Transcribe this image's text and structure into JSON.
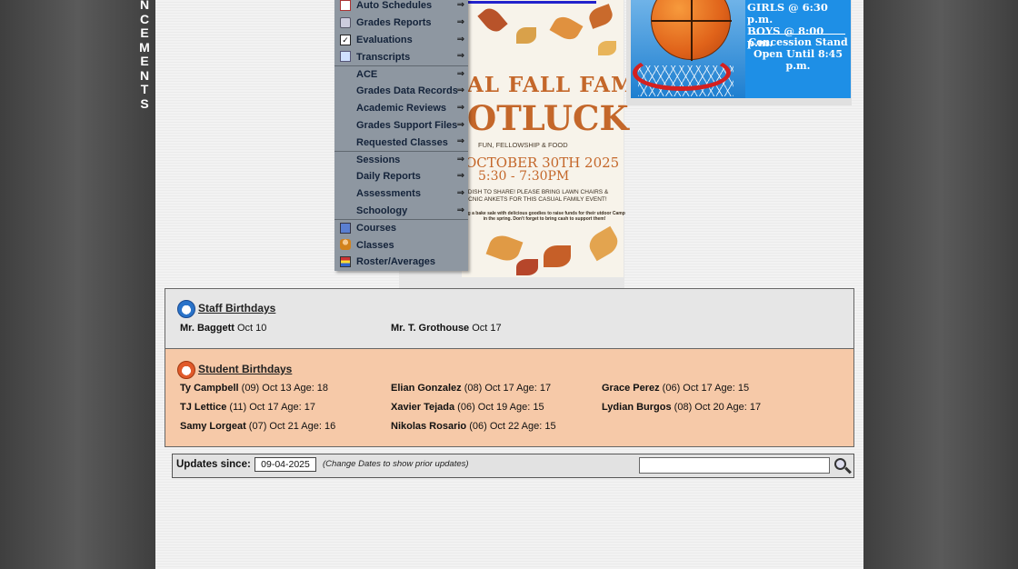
{
  "sidebar": {
    "vertical_letters": [
      "N",
      "C",
      "E",
      "M",
      "E",
      "N",
      "T",
      "S"
    ]
  },
  "menu": {
    "items": [
      {
        "label": "Auto Schedules",
        "icon": "calendar-icon",
        "arrow": "⇒"
      },
      {
        "label": "Grades Reports",
        "icon": "printer-icon",
        "arrow": "⇒"
      },
      {
        "label": "Evaluations",
        "icon": "checkbox-icon",
        "arrow": "⇒"
      },
      {
        "label": "Transcripts",
        "icon": "document-icon",
        "arrow": "⇒"
      },
      {
        "label": "ACE",
        "icon": "",
        "arrow": "⇒"
      },
      {
        "label": "Grades Data Records",
        "icon": "",
        "arrow": "⇒"
      },
      {
        "label": "Academic Reviews",
        "icon": "",
        "arrow": "⇒"
      },
      {
        "label": "Grades Support Files",
        "icon": "",
        "arrow": "⇒"
      },
      {
        "label": "Requested Classes",
        "icon": "",
        "arrow": "⇒"
      },
      {
        "label": "Sessions",
        "icon": "",
        "arrow": "⇒"
      },
      {
        "label": "Daily Reports",
        "icon": "",
        "arrow": "⇒"
      },
      {
        "label": "Assessments",
        "icon": "",
        "arrow": "⇒"
      },
      {
        "label": "Schoology",
        "icon": "",
        "arrow": "⇒"
      },
      {
        "label": "Courses",
        "icon": "book-icon",
        "arrow": ""
      },
      {
        "label": "Classes",
        "icon": "person-icon",
        "arrow": ""
      },
      {
        "label": "Roster/Averages",
        "icon": "roster-icon",
        "arrow": ""
      }
    ]
  },
  "flyer": {
    "title_line1": "AL FALL FAMILY",
    "title_line2": "OTLUCK",
    "subtitle": "FUN, FELLOWSHIP & FOOD",
    "date": "OCTOBER 30TH 2025",
    "time": "5:30 - 7:30PM",
    "note1": "A DISH TO SHARE! PLEASE BRING LAWN CHAIRS & PICNIC ANKETS FOR THIS CASUAL FAMILY EVENT!",
    "note2": "ing a bake sale with delicious goodies to raise funds for their utdoor Camp in the spring. Don't forget to bring cash to support them!"
  },
  "basketball_ad": {
    "line_girls": "GIRLS @ 6:30 p.m.",
    "line_boys": "BOYS  @ 8:00 p.m.",
    "line_stand1": "Concession Stand",
    "line_stand2": "Open Until 8:45 p.m."
  },
  "staff_birthdays": {
    "heading": "Staff Birthdays",
    "entries": [
      {
        "name": "Mr. Baggett",
        "detail": " Oct 10"
      },
      {
        "name": "Mr. T. Grothouse",
        "detail": " Oct 17"
      }
    ]
  },
  "student_birthdays": {
    "heading": "Student Birthdays",
    "entries": [
      {
        "name": "Ty Campbell",
        "detail": " (09) Oct 13 Age: 18"
      },
      {
        "name": "Elian Gonzalez",
        "detail": " (08) Oct 17 Age: 17"
      },
      {
        "name": "Grace Perez",
        "detail": " (06) Oct 17 Age: 15"
      },
      {
        "name": "TJ Lettice",
        "detail": " (11) Oct 17 Age: 17"
      },
      {
        "name": "Xavier Tejada",
        "detail": " (06) Oct 19 Age: 15"
      },
      {
        "name": "Lydian Burgos",
        "detail": " (08) Oct 20 Age: 17"
      },
      {
        "name": "Samy Lorgeat",
        "detail": " (07) Oct 21 Age: 16"
      },
      {
        "name": "Nikolas Rosario",
        "detail": " (06) Oct 22 Age: 15"
      }
    ]
  },
  "updates": {
    "label": "Updates since:",
    "date_value": "09-04-2025",
    "hint": "(Change Dates to show prior updates)",
    "search_value": ""
  },
  "colors": {
    "menu_bg": "#8e97a1",
    "staff_bg": "#e6e6e6",
    "student_bg": "#f6c9a8",
    "ad_blue": "#1e8fe6"
  }
}
